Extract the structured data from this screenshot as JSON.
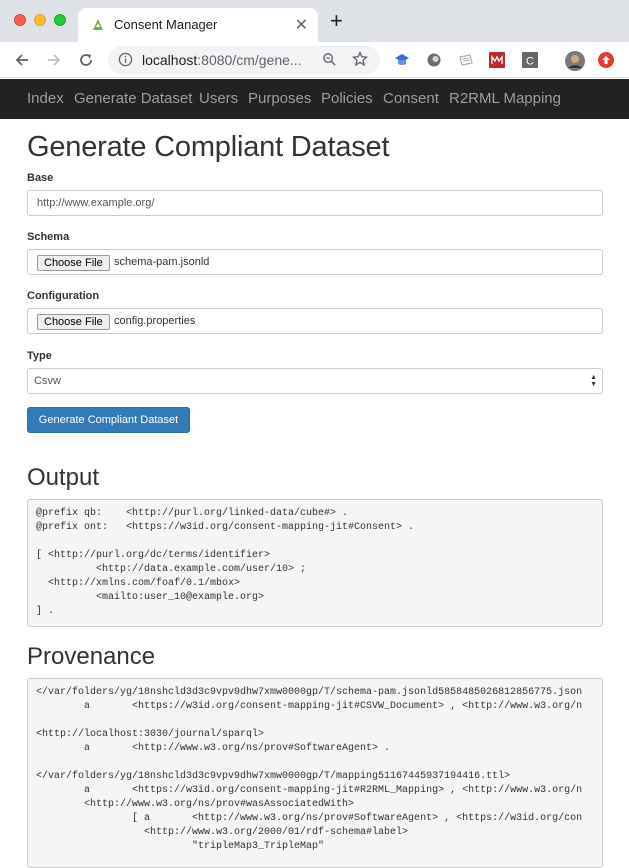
{
  "browser": {
    "tab_title": "Consent Manager",
    "url_host": "localhost",
    "url_rest": ":8080/cm/gene..."
  },
  "navbar": {
    "items": [
      "Index",
      "Generate Dataset",
      "Users",
      "Purposes",
      "Policies",
      "Consent",
      "R2RML Mapping"
    ]
  },
  "page": {
    "title": "Generate Compliant Dataset",
    "base": {
      "label": "Base",
      "value": "http://www.example.org/"
    },
    "schema": {
      "label": "Schema",
      "button": "Choose File",
      "file": "schema-pam.jsonld"
    },
    "configuration": {
      "label": "Configuration",
      "button": "Choose File",
      "file": "config.properties"
    },
    "type": {
      "label": "Type",
      "selected": "Csvw"
    },
    "submit": "Generate Compliant Dataset"
  },
  "output": {
    "title": "Output",
    "lines": [
      "@prefix qb:    <http://purl.org/linked-data/cube#> .",
      "@prefix ont:   <https://w3id.org/consent-mapping-jit#Consent> .",
      "",
      "[ <http://purl.org/dc/terms/identifier>",
      "          <http://data.example.com/user/10> ;",
      "  <http://xmlns.com/foaf/0.1/mbox>",
      "          <mailto:user_10@example.org>",
      "] ."
    ]
  },
  "provenance": {
    "title": "Provenance",
    "lines": [
      "</var/folders/yg/18nshcld3d3c9vpv9dhw7xmw0000gp/T/schema-pam.jsonld5858485026812856775.json",
      "        a       <https://w3id.org/consent-mapping-jit#CSVW_Document> , <http://www.w3.org/n",
      "",
      "<http://localhost:3030/journal/sparql>",
      "        a       <http://www.w3.org/ns/prov#SoftwareAgent> .",
      "",
      "</var/folders/yg/18nshcld3d3c9vpv9dhw7xmw0000gp/T/mapping51167445937194416.ttl>",
      "        a       <https://w3id.org/consent-mapping-jit#R2RML_Mapping> , <http://www.w3.org/n",
      "        <http://www.w3.org/ns/prov#wasAssociatedWith>",
      "                [ a       <http://www.w3.org/ns/prov#SoftwareAgent> , <https://w3id.org/con",
      "                  <http://www.w3.org/2000/01/rdf-schema#label>",
      "                          \"tripleMap3_TripleMap\""
    ]
  },
  "colors": {
    "navbar_bg": "#222222",
    "primary": "#337ab7",
    "pre_bg": "#f5f5f5"
  }
}
